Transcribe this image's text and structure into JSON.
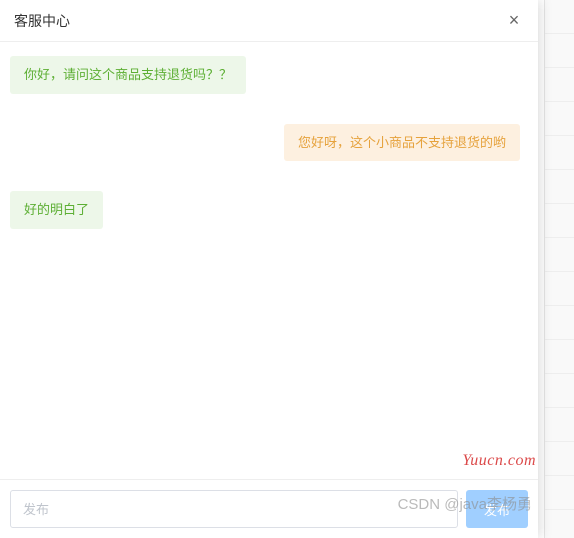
{
  "header": {
    "title": "客服中心",
    "close": "×"
  },
  "messages": [
    {
      "side": "left",
      "role": "user",
      "text": "你好，请问这个商品支持退货吗？？"
    },
    {
      "side": "right",
      "role": "agent",
      "text": "您好呀，这个小商品不支持退货的哟"
    },
    {
      "side": "left",
      "role": "user",
      "text": "好的明白了"
    }
  ],
  "footer": {
    "placeholder": "发布",
    "send_label": "发布"
  },
  "watermark": {
    "site": "Yuucn.com",
    "csdn": "CSDN @java李杨勇"
  }
}
